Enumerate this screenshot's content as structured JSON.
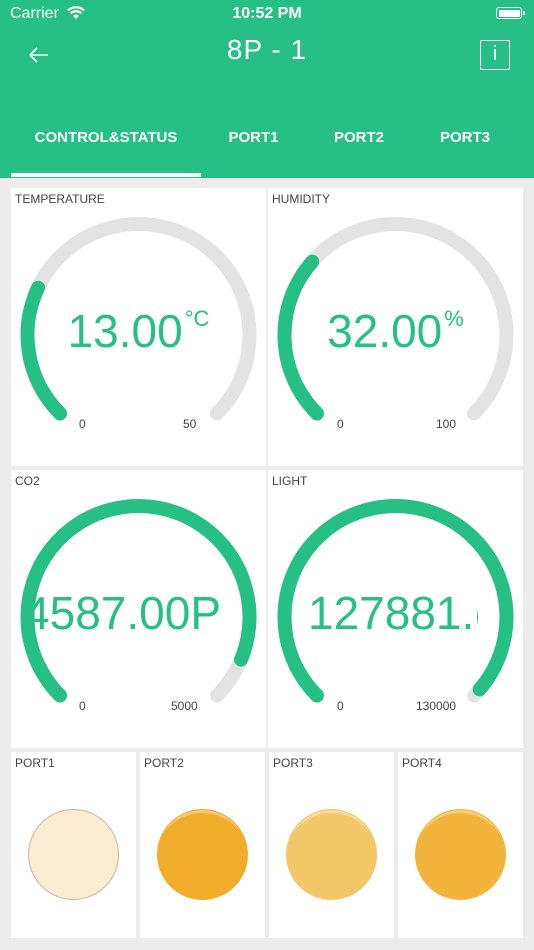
{
  "status_bar": {
    "carrier": "Carrier",
    "time": "10:52 PM"
  },
  "header": {
    "title": "8P - 1",
    "info_label": "i"
  },
  "tabs": [
    {
      "label": "CONTROL&STATUS",
      "active": true
    },
    {
      "label": "PORT1"
    },
    {
      "label": "PORT2"
    },
    {
      "label": "PORT3"
    }
  ],
  "gauges": {
    "temperature": {
      "label": "TEMPERATURE",
      "value": "13.00",
      "unit": "°C",
      "min": "0",
      "max": "50",
      "fraction": 0.26
    },
    "humidity": {
      "label": "HUMIDITY",
      "value": "32.00",
      "unit": "%",
      "min": "0",
      "max": "100",
      "fraction": 0.32
    },
    "co2": {
      "label": "CO2",
      "value": "4587.00",
      "unit": "P",
      "min": "0",
      "max": "5000",
      "fraction": 0.917
    },
    "light": {
      "label": "LIGHT",
      "value": "127881.(",
      "unit": "",
      "min": "0",
      "max": "130000",
      "fraction": 0.984
    }
  },
  "ports": [
    {
      "label": "PORT1",
      "color": "#fbecd2",
      "border": "#c9b8a4"
    },
    {
      "label": "PORT2",
      "color": "#f0ac2a",
      "border": "#f0ac2a"
    },
    {
      "label": "PORT3",
      "color": "#f4c869",
      "border": "#f4c869"
    },
    {
      "label": "PORT4",
      "color": "#f2b43b",
      "border": "#f2b43b"
    }
  ],
  "colors": {
    "accent": "#26c087",
    "track": "#e3e3e3"
  }
}
